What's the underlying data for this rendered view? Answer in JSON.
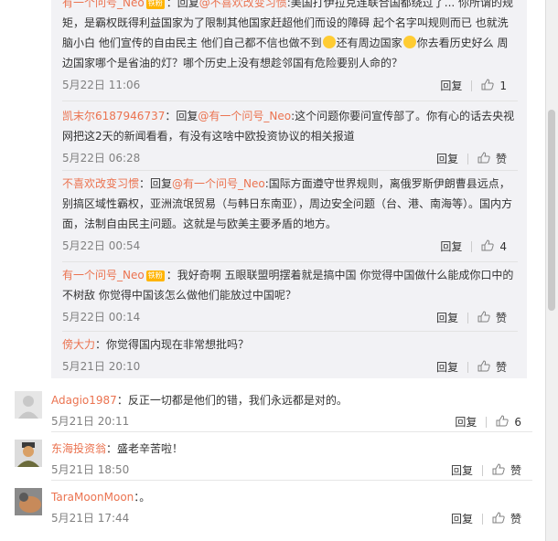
{
  "replies": [
    {
      "user": "有一个问号_Neo",
      "badge": "铁粉",
      "prefix": "：回复",
      "mention": "@不喜欢改变习惯",
      "text": ":美国打伊拉克连联合国都绕过了... 你所谓的规矩，是霸权既得利益国家为了限制其他国家赶超他们而设的障碍 起个名字叫规则而已 也就洗脑小白 他们宣传的自由民主 他们自己都不信也做不到",
      "text2": "还有周边国家",
      "text3": "你去看历史好么 周边国家哪个是省油的灯？哪个历史上没有想趁邻国有危险要别人命的？",
      "time": "5月22日 11:06",
      "reply_label": "回复",
      "likes": "1"
    },
    {
      "user": "凯末尔6187946737",
      "prefix": "：回复",
      "mention": "@有一个问号_Neo",
      "text": ":这个问题你要问宣传部了。你有心的话去央视网把这2天的新闻看看，有没有这啥中欧投资协议的相关报道",
      "time": "5月22日 06:28",
      "reply_label": "回复",
      "likes": "赞"
    },
    {
      "user": "不喜欢改变习惯",
      "prefix": "：回复",
      "mention": "@有一个问号_Neo",
      "text": ":国际方面遵守世界规则，离俄罗斯伊朗曹县远点，别搞区域性霸权，亚洲流氓贸易（与韩日东南亚），周边安全问题（台、港、南海等）。国内方面，法制自由民主问题。这就是与欧美主要矛盾的地方。",
      "time": "5月22日 00:54",
      "reply_label": "回复",
      "likes": "4"
    },
    {
      "user": "有一个问号_Neo",
      "badge": "铁粉",
      "text": "：我好奇啊 五眼联盟明摆着就是搞中国 你觉得中国做什么能成你口中的不树敌 你觉得中国该怎么做他们能放过中国呢？",
      "time": "5月22日 00:14",
      "reply_label": "回复",
      "likes": "赞"
    },
    {
      "user": "傍大力",
      "text": "：你觉得国内现在非常想批吗？",
      "time": "5月21日 20:10",
      "reply_label": "回复",
      "likes": "赞"
    }
  ],
  "comments": [
    {
      "user": "Adagio1987",
      "text": "：反正一切都是他们的错，我们永远都是对的。",
      "time": "5月21日 20:11",
      "reply_label": "回复",
      "likes": "6"
    },
    {
      "user": "东海投资翁",
      "text": "：盛老辛苦啦！",
      "time": "5月21日 18:50",
      "reply_label": "回复",
      "likes": "赞"
    },
    {
      "user": "TaraMoonMoon",
      "text": "：。",
      "time": "5月21日 17:44",
      "reply_label": "回复",
      "likes": "赞"
    }
  ],
  "colors": {
    "link": "#eb7350",
    "text": "#333333",
    "meta": "#808080",
    "reply_bg": "#f2f2f5"
  }
}
